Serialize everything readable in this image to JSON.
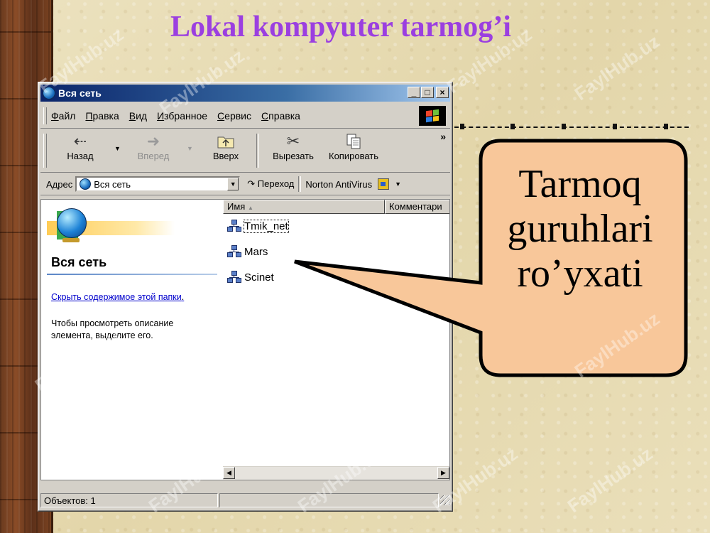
{
  "slide": {
    "title": "Lokal kompyuter tarmog’i",
    "callout_lines": [
      "Tarmoq",
      "guruhlari",
      "ro’yxati"
    ],
    "watermark": "FaylHub.uz",
    "title_color": "#9b3fe0"
  },
  "window": {
    "title": "Вся сеть",
    "controls": {
      "minimize": "_",
      "maximize": "□",
      "close": "×"
    },
    "menu": [
      "Файл",
      "Правка",
      "Вид",
      "Избранное",
      "Сервис",
      "Справка"
    ],
    "toolbar": {
      "back": "Назад",
      "forward": "Вперед",
      "up": "Вверх",
      "cut": "Вырезать",
      "copy": "Копировать",
      "chevron": "»"
    },
    "address": {
      "label": "Адрес",
      "value": "Вся сеть",
      "go": "Переход",
      "norton": "Norton AntiVirus"
    },
    "left_pane": {
      "title": "Вся сеть",
      "link": "Скрыть содержимое этой папки",
      "link_suffix": ".",
      "description": "Чтобы просмотреть описание элемента, выделите его."
    },
    "columns": [
      "Имя",
      "Комментари"
    ],
    "sort_indicator": "▲",
    "items": [
      {
        "name": "Tmik_net",
        "icon": "workgroup-icon",
        "selected": true
      },
      {
        "name": "Mars",
        "icon": "workgroup-icon",
        "selected": false
      },
      {
        "name": "Scinet",
        "icon": "workgroup-icon",
        "selected": false
      }
    ],
    "status": "Объектов: 1"
  }
}
